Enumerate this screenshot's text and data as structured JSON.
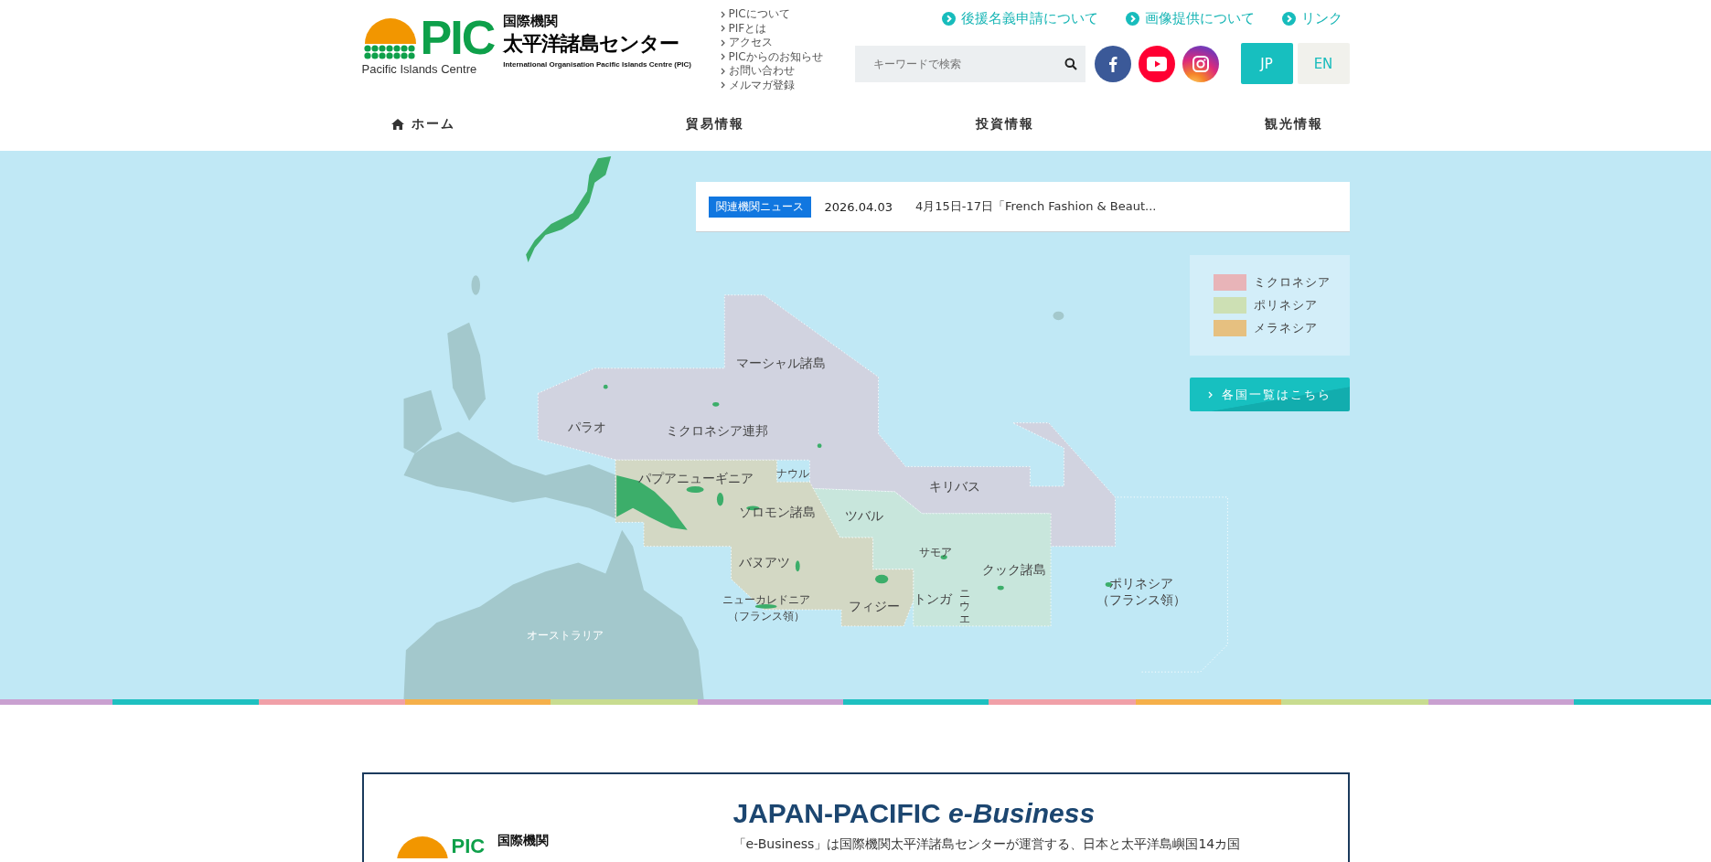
{
  "header": {
    "logo": {
      "mark": "PIC",
      "tagline": "Pacific Islands Centre",
      "org_label": "国際機関",
      "name": "太平洋諸島センター",
      "english_name": "International Organisation  Pacific Islands Centre (PIC)"
    },
    "quick_links": [
      "PICについて",
      "PIFとは",
      "アクセス",
      "PICからのお知らせ",
      "お問い合わせ",
      "メルマガ登録"
    ],
    "top_links": [
      "後援名義申請について",
      "画像提供について",
      "リンク"
    ],
    "search": {
      "placeholder": "キーワードで検索"
    },
    "social": [
      {
        "kind": "facebook"
      },
      {
        "kind": "youtube"
      },
      {
        "kind": "instagram"
      }
    ],
    "languages": [
      {
        "label": "JP",
        "selected": true
      },
      {
        "label": "EN",
        "selected": false
      }
    ]
  },
  "nav": [
    {
      "label": "ホーム",
      "kind": "home"
    },
    {
      "label": "貿易情報",
      "kind": "plain"
    },
    {
      "label": "投資情報",
      "kind": "plain"
    },
    {
      "label": "観光情報",
      "kind": "plain"
    }
  ],
  "news": {
    "tag": "関連機関ニュース",
    "date": "2026.04.03",
    "title": "4月15日-17日「French Fashion & Beaut..."
  },
  "legend": [
    {
      "label": "ミクロネシア",
      "color": "#e8b4b8"
    },
    {
      "label": "ポリネシア",
      "color": "#cde0b4"
    },
    {
      "label": "メラネシア",
      "color": "#e6c080"
    }
  ],
  "country_list_button": {
    "label": "各国一覧はこちら"
  },
  "map_labels": [
    {
      "kind": "normal",
      "lines": [
        "マーシャル諸島"
      ]
    },
    {
      "kind": "normal",
      "lines": [
        "パラオ"
      ]
    },
    {
      "kind": "normal",
      "lines": [
        "ミクロネシア連邦"
      ]
    },
    {
      "kind": "small",
      "lines": [
        "ナウル"
      ]
    },
    {
      "kind": "normal",
      "lines": [
        "パプアニューギニア"
      ]
    },
    {
      "kind": "normal",
      "lines": [
        "キリバス"
      ]
    },
    {
      "kind": "normal",
      "lines": [
        "ソロモン諸島"
      ]
    },
    {
      "kind": "normal",
      "lines": [
        "ツバル"
      ]
    },
    {
      "kind": "small",
      "lines": [
        "サモア"
      ]
    },
    {
      "kind": "normal",
      "lines": [
        "クック諸島"
      ]
    },
    {
      "kind": "normal",
      "lines": [
        "バヌアツ"
      ]
    },
    {
      "kind": "small",
      "lines": [
        "ニューカレドニア",
        "（フランス領）"
      ]
    },
    {
      "kind": "normal",
      "lines": [
        "フィジー"
      ]
    },
    {
      "kind": "normal",
      "lines": [
        "トンガ"
      ]
    },
    {
      "kind": "vertical",
      "lines": [
        "ニウエ"
      ]
    },
    {
      "kind": "normal",
      "lines": [
        "ポリネシア",
        "（フランス領）"
      ]
    },
    {
      "kind": "land",
      "lines": [
        "オーストラリア"
      ]
    }
  ],
  "ebusiness": {
    "logo": {
      "mark": "PIC",
      "org_label": "国際機関"
    },
    "title": "JAPAN-PACIFIC *e-Business*",
    "text": "「e-Business」は国際機関太平洋諸島センターが運営する、日本と太平洋島嶼国14カ国"
  }
}
